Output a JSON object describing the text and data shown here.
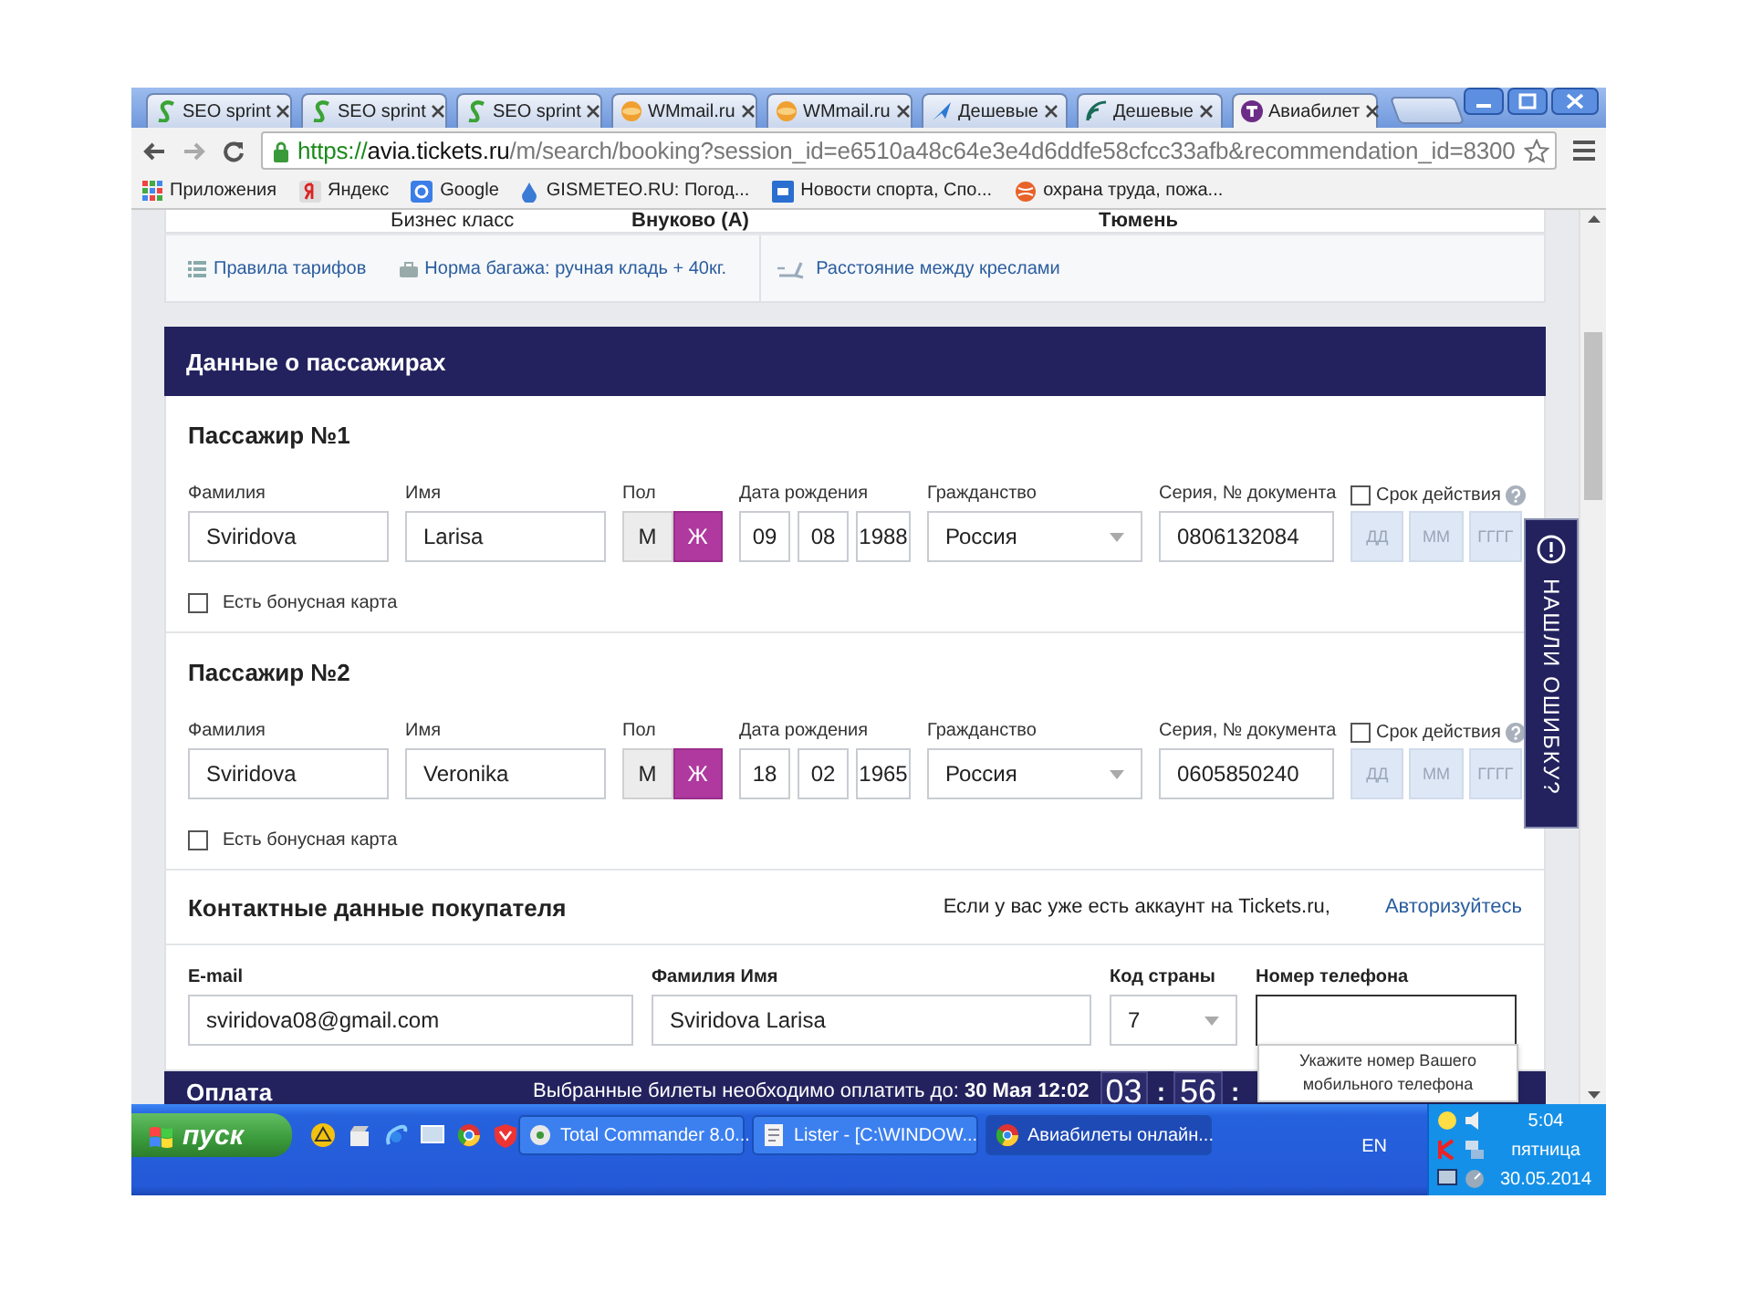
{
  "browser": {
    "tabs": [
      {
        "kind": "seo",
        "title": "SEO sprint",
        "selected": false
      },
      {
        "kind": "seo",
        "title": "SEO sprint",
        "selected": false
      },
      {
        "kind": "seo",
        "title": "SEO sprint",
        "selected": false
      },
      {
        "kind": "mail",
        "title": "WMmail.ru",
        "selected": false
      },
      {
        "kind": "mail",
        "title": "WMmail.ru",
        "selected": false
      },
      {
        "kind": "plane",
        "title": "Дешевые",
        "selected": false
      },
      {
        "kind": "waves",
        "title": "Дешевые",
        "selected": false
      },
      {
        "kind": "avia",
        "title": "Авиабилет",
        "selected": true
      }
    ],
    "address": {
      "scheme": "https://",
      "host": "avia.tickets.ru",
      "path": "/m/search/booking?session_id=e6510a48c64e3e4d6ddfe58cfcc33afb&recommendation_id=8300"
    },
    "bookmarks": [
      {
        "kind": "apps",
        "label": "Приложения"
      },
      {
        "kind": "yandex",
        "label": "Яндекс"
      },
      {
        "kind": "google",
        "label": "Google"
      },
      {
        "kind": "drop",
        "label": "GISMETEO.RU: Погод..."
      },
      {
        "kind": "news",
        "label": "Новости спорта, Спо..."
      },
      {
        "kind": "ball",
        "label": "охрана труда, пожа..."
      }
    ]
  },
  "flight": {
    "summary": [
      "Бизнес класс",
      "Внуково (А)",
      "Тюмень"
    ],
    "links": [
      {
        "kind": "list",
        "label": "Правила тарифов"
      },
      {
        "kind": "bag",
        "label": "Норма багажа: ручная кладь + 40кг."
      },
      {
        "kind": "seat",
        "label": "Расстояние между креслами"
      }
    ]
  },
  "passengers": {
    "title": "Данные о пассажирах",
    "items": [
      {
        "heading": "Пассажир №1",
        "surname": {
          "label": "Фамилия",
          "value": "Sviridova"
        },
        "name": {
          "label": "Имя",
          "value": "Larisa"
        },
        "gender": {
          "label": "Пол",
          "options": [
            {
              "label": "М",
              "selected": false
            },
            {
              "label": "Ж",
              "selected": true
            }
          ]
        },
        "birth": {
          "label": "Дата рождения",
          "fields": [
            {
              "value": "09"
            },
            {
              "value": "08"
            },
            {
              "value": "1988"
            }
          ]
        },
        "citizenship": {
          "label": "Гражданство",
          "value": "Россия"
        },
        "document": {
          "label": "Серия, № документа",
          "value": "0806132084"
        },
        "expiry": {
          "label": "Срок действия",
          "checked": false,
          "fields": [
            {
              "placeholder": "ДД"
            },
            {
              "placeholder": "ММ"
            },
            {
              "placeholder": "ГГГГ"
            }
          ]
        },
        "bonus": {
          "label": "Есть бонусная карта",
          "checked": false
        }
      },
      {
        "heading": "Пассажир №2",
        "surname": {
          "label": "Фамилия",
          "value": "Sviridova"
        },
        "name": {
          "label": "Имя",
          "value": "Veronika"
        },
        "gender": {
          "label": "Пол",
          "options": [
            {
              "label": "М",
              "selected": false
            },
            {
              "label": "Ж",
              "selected": true
            }
          ]
        },
        "birth": {
          "label": "Дата рождения",
          "fields": [
            {
              "value": "18"
            },
            {
              "value": "02"
            },
            {
              "value": "1965"
            }
          ]
        },
        "citizenship": {
          "label": "Гражданство",
          "value": "Россия"
        },
        "document": {
          "label": "Серия, № документа",
          "value": "0605850240"
        },
        "expiry": {
          "label": "Срок действия",
          "checked": false,
          "fields": [
            {
              "placeholder": "ДД"
            },
            {
              "placeholder": "ММ"
            },
            {
              "placeholder": "ГГГГ"
            }
          ]
        },
        "bonus": {
          "label": "Есть бонусная карта",
          "checked": false
        }
      }
    ]
  },
  "contact": {
    "title": "Контактные данные покупателя",
    "note": "Если у вас уже есть аккаунт на Tickets.ru,",
    "login": "Авторизуйтесь",
    "fields": [
      {
        "kind": "text",
        "label": "E-mail",
        "value": "sviridova08@gmail.com"
      },
      {
        "kind": "text",
        "label": "Фамилия Имя",
        "value": "Sviridova Larisa"
      },
      {
        "kind": "select",
        "label": "Код страны",
        "value": "7"
      },
      {
        "kind": "text",
        "label": "Номер телефона",
        "focused": true
      }
    ],
    "tooltip": "Укажите номер Вашего мобильного телефона"
  },
  "payment": {
    "title": "Оплата",
    "deadline": "Выбранные билеты необходимо оплатить до: **30 Мая 12:02**",
    "timer": [
      {
        "kind": "digits",
        "text": "03"
      },
      {
        "kind": "separator",
        "text": ":"
      },
      {
        "kind": "digits",
        "text": "56"
      },
      {
        "kind": "separator",
        "text": ":"
      }
    ]
  },
  "feedback": {
    "label": "НАШЛИ ОШИБКУ?"
  },
  "taskbar": {
    "start": "пуск",
    "tasks": [
      {
        "kind": "commander",
        "title": "Total Commander 8.0...",
        "selected": false
      },
      {
        "kind": "lister",
        "title": "Lister - [C:\\WINDOW...",
        "selected": false
      },
      {
        "kind": "browser",
        "title": "Авиабилеты онлайн...",
        "selected": true
      }
    ],
    "language": "EN",
    "clock": {
      "time": "5:04",
      "day": "пятница",
      "date": "30.05.2014"
    }
  }
}
